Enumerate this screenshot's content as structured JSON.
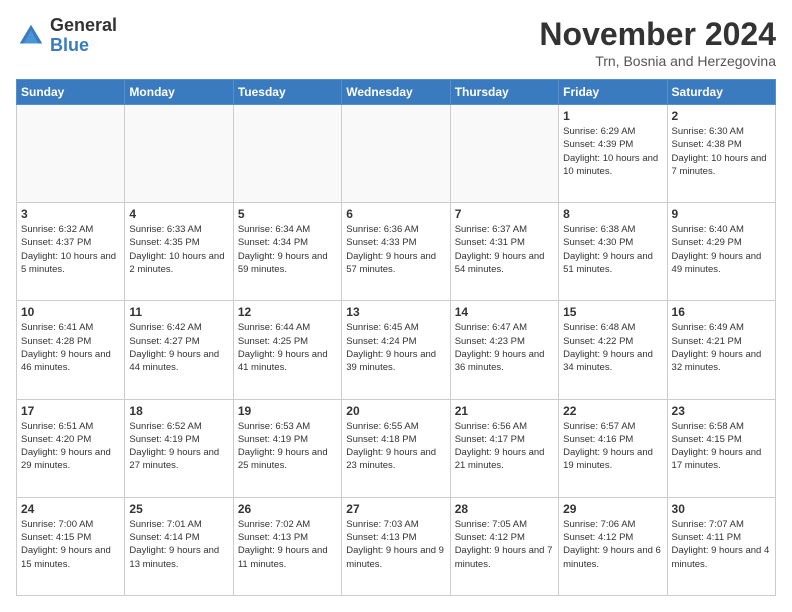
{
  "logo": {
    "general": "General",
    "blue": "Blue"
  },
  "header": {
    "month": "November 2024",
    "location": "Trn, Bosnia and Herzegovina"
  },
  "weekdays": [
    "Sunday",
    "Monday",
    "Tuesday",
    "Wednesday",
    "Thursday",
    "Friday",
    "Saturday"
  ],
  "weeks": [
    [
      {
        "day": "",
        "info": ""
      },
      {
        "day": "",
        "info": ""
      },
      {
        "day": "",
        "info": ""
      },
      {
        "day": "",
        "info": ""
      },
      {
        "day": "",
        "info": ""
      },
      {
        "day": "1",
        "info": "Sunrise: 6:29 AM\nSunset: 4:39 PM\nDaylight: 10 hours and 10 minutes."
      },
      {
        "day": "2",
        "info": "Sunrise: 6:30 AM\nSunset: 4:38 PM\nDaylight: 10 hours and 7 minutes."
      }
    ],
    [
      {
        "day": "3",
        "info": "Sunrise: 6:32 AM\nSunset: 4:37 PM\nDaylight: 10 hours and 5 minutes."
      },
      {
        "day": "4",
        "info": "Sunrise: 6:33 AM\nSunset: 4:35 PM\nDaylight: 10 hours and 2 minutes."
      },
      {
        "day": "5",
        "info": "Sunrise: 6:34 AM\nSunset: 4:34 PM\nDaylight: 9 hours and 59 minutes."
      },
      {
        "day": "6",
        "info": "Sunrise: 6:36 AM\nSunset: 4:33 PM\nDaylight: 9 hours and 57 minutes."
      },
      {
        "day": "7",
        "info": "Sunrise: 6:37 AM\nSunset: 4:31 PM\nDaylight: 9 hours and 54 minutes."
      },
      {
        "day": "8",
        "info": "Sunrise: 6:38 AM\nSunset: 4:30 PM\nDaylight: 9 hours and 51 minutes."
      },
      {
        "day": "9",
        "info": "Sunrise: 6:40 AM\nSunset: 4:29 PM\nDaylight: 9 hours and 49 minutes."
      }
    ],
    [
      {
        "day": "10",
        "info": "Sunrise: 6:41 AM\nSunset: 4:28 PM\nDaylight: 9 hours and 46 minutes."
      },
      {
        "day": "11",
        "info": "Sunrise: 6:42 AM\nSunset: 4:27 PM\nDaylight: 9 hours and 44 minutes."
      },
      {
        "day": "12",
        "info": "Sunrise: 6:44 AM\nSunset: 4:25 PM\nDaylight: 9 hours and 41 minutes."
      },
      {
        "day": "13",
        "info": "Sunrise: 6:45 AM\nSunset: 4:24 PM\nDaylight: 9 hours and 39 minutes."
      },
      {
        "day": "14",
        "info": "Sunrise: 6:47 AM\nSunset: 4:23 PM\nDaylight: 9 hours and 36 minutes."
      },
      {
        "day": "15",
        "info": "Sunrise: 6:48 AM\nSunset: 4:22 PM\nDaylight: 9 hours and 34 minutes."
      },
      {
        "day": "16",
        "info": "Sunrise: 6:49 AM\nSunset: 4:21 PM\nDaylight: 9 hours and 32 minutes."
      }
    ],
    [
      {
        "day": "17",
        "info": "Sunrise: 6:51 AM\nSunset: 4:20 PM\nDaylight: 9 hours and 29 minutes."
      },
      {
        "day": "18",
        "info": "Sunrise: 6:52 AM\nSunset: 4:19 PM\nDaylight: 9 hours and 27 minutes."
      },
      {
        "day": "19",
        "info": "Sunrise: 6:53 AM\nSunset: 4:19 PM\nDaylight: 9 hours and 25 minutes."
      },
      {
        "day": "20",
        "info": "Sunrise: 6:55 AM\nSunset: 4:18 PM\nDaylight: 9 hours and 23 minutes."
      },
      {
        "day": "21",
        "info": "Sunrise: 6:56 AM\nSunset: 4:17 PM\nDaylight: 9 hours and 21 minutes."
      },
      {
        "day": "22",
        "info": "Sunrise: 6:57 AM\nSunset: 4:16 PM\nDaylight: 9 hours and 19 minutes."
      },
      {
        "day": "23",
        "info": "Sunrise: 6:58 AM\nSunset: 4:15 PM\nDaylight: 9 hours and 17 minutes."
      }
    ],
    [
      {
        "day": "24",
        "info": "Sunrise: 7:00 AM\nSunset: 4:15 PM\nDaylight: 9 hours and 15 minutes."
      },
      {
        "day": "25",
        "info": "Sunrise: 7:01 AM\nSunset: 4:14 PM\nDaylight: 9 hours and 13 minutes."
      },
      {
        "day": "26",
        "info": "Sunrise: 7:02 AM\nSunset: 4:13 PM\nDaylight: 9 hours and 11 minutes."
      },
      {
        "day": "27",
        "info": "Sunrise: 7:03 AM\nSunset: 4:13 PM\nDaylight: 9 hours and 9 minutes."
      },
      {
        "day": "28",
        "info": "Sunrise: 7:05 AM\nSunset: 4:12 PM\nDaylight: 9 hours and 7 minutes."
      },
      {
        "day": "29",
        "info": "Sunrise: 7:06 AM\nSunset: 4:12 PM\nDaylight: 9 hours and 6 minutes."
      },
      {
        "day": "30",
        "info": "Sunrise: 7:07 AM\nSunset: 4:11 PM\nDaylight: 9 hours and 4 minutes."
      }
    ]
  ]
}
